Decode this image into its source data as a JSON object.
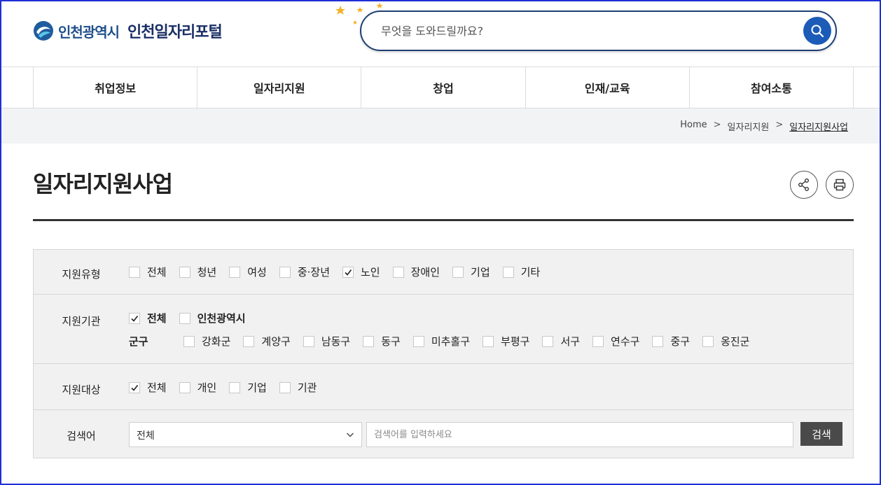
{
  "header": {
    "city_name": "인천광역시",
    "portal_name": "인천일자리포털",
    "search_placeholder": "무엇을 도와드릴까요?",
    "accent_color": "#1c5bb8"
  },
  "nav": [
    "취업정보",
    "일자리지원",
    "창업",
    "인재/교육",
    "참여소통"
  ],
  "breadcrumb": {
    "home": "Home",
    "sep": ">",
    "level1": "일자리지원",
    "current": "일자리지원사업"
  },
  "page_title": "일자리지원사업",
  "filters": {
    "type": {
      "label": "지원유형",
      "options": [
        {
          "text": "전체",
          "checked": false
        },
        {
          "text": "청년",
          "checked": false
        },
        {
          "text": "여성",
          "checked": false
        },
        {
          "text": "중·장년",
          "checked": false
        },
        {
          "text": "노인",
          "checked": true
        },
        {
          "text": "장애인",
          "checked": false
        },
        {
          "text": "기업",
          "checked": false
        },
        {
          "text": "기타",
          "checked": false
        }
      ]
    },
    "org": {
      "label": "지원기관",
      "options": [
        {
          "text": "전체",
          "checked": true
        },
        {
          "text": "인천광역시",
          "checked": false
        }
      ],
      "district_label": "군구",
      "districts": [
        {
          "text": "강화군",
          "checked": false
        },
        {
          "text": "계양구",
          "checked": false
        },
        {
          "text": "남동구",
          "checked": false
        },
        {
          "text": "동구",
          "checked": false
        },
        {
          "text": "미추홀구",
          "checked": false
        },
        {
          "text": "부평구",
          "checked": false
        },
        {
          "text": "서구",
          "checked": false
        },
        {
          "text": "연수구",
          "checked": false
        },
        {
          "text": "중구",
          "checked": false
        },
        {
          "text": "옹진군",
          "checked": false
        }
      ]
    },
    "target": {
      "label": "지원대상",
      "options": [
        {
          "text": "전체",
          "checked": true
        },
        {
          "text": "개인",
          "checked": false
        },
        {
          "text": "기업",
          "checked": false
        },
        {
          "text": "기관",
          "checked": false
        }
      ]
    },
    "keyword": {
      "label": "검색어",
      "select_value": "전체",
      "input_placeholder": "검색어를 입력하세요",
      "button_label": "검색"
    }
  }
}
